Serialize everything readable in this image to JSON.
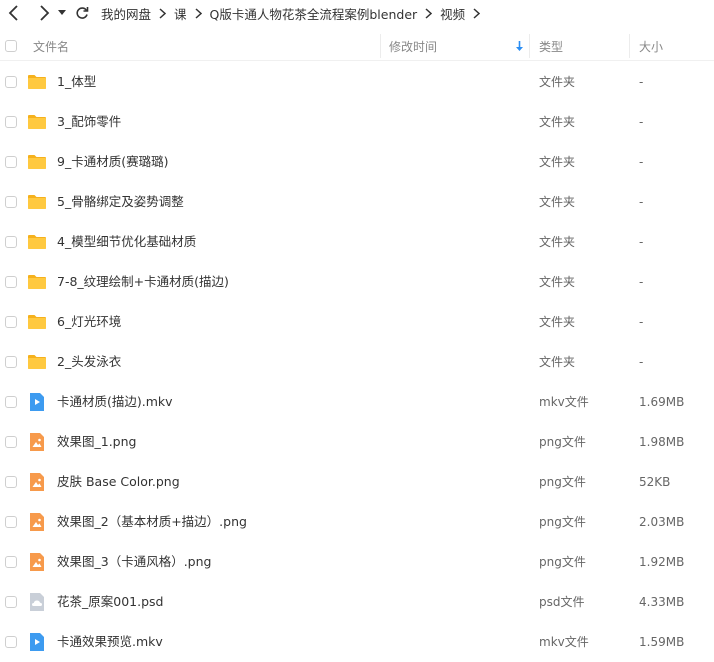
{
  "nav": {
    "back_icon": "chevron-left-icon",
    "forward_icon": "chevron-right-icon",
    "history_icon": "caret-down-icon",
    "refresh_icon": "refresh-icon"
  },
  "breadcrumb": [
    "我的网盘",
    "课",
    "Q版卡通人物花茶全流程案例blender",
    "视频"
  ],
  "columns": {
    "name": "文件名",
    "modified": "修改时间",
    "type": "类型",
    "size": "大小",
    "sort_icon": "sort-down-arrow-icon"
  },
  "colors": {
    "folder": "#ffc940",
    "folder_tab": "#f5b11d",
    "video": "#3d9bf0",
    "image": "#f79a4b",
    "psd": "#c9cfd8",
    "accent": "#2b8ef3"
  },
  "files": [
    {
      "name": "1_体型",
      "type": "文件夹",
      "size": "-",
      "icon": "folder-icon"
    },
    {
      "name": "3_配饰零件",
      "type": "文件夹",
      "size": "-",
      "icon": "folder-icon"
    },
    {
      "name": "9_卡通材质(赛璐璐)",
      "type": "文件夹",
      "size": "-",
      "icon": "folder-icon"
    },
    {
      "name": "5_骨骼绑定及姿势调整",
      "type": "文件夹",
      "size": "-",
      "icon": "folder-icon"
    },
    {
      "name": "4_模型细节优化基础材质",
      "type": "文件夹",
      "size": "-",
      "icon": "folder-icon"
    },
    {
      "name": "7-8_纹理绘制+卡通材质(描边)",
      "type": "文件夹",
      "size": "-",
      "icon": "folder-icon"
    },
    {
      "name": "6_灯光环境",
      "type": "文件夹",
      "size": "-",
      "icon": "folder-icon"
    },
    {
      "name": "2_头发泳衣",
      "type": "文件夹",
      "size": "-",
      "icon": "folder-icon"
    },
    {
      "name": "卡通材质(描边).mkv",
      "type": "mkv文件",
      "size": "1.69MB",
      "icon": "video-file-icon"
    },
    {
      "name": "效果图_1.png",
      "type": "png文件",
      "size": "1.98MB",
      "icon": "image-file-icon"
    },
    {
      "name": "皮肤 Base Color.png",
      "type": "png文件",
      "size": "52KB",
      "icon": "image-file-icon"
    },
    {
      "name": "效果图_2（基本材质+描边）.png",
      "type": "png文件",
      "size": "2.03MB",
      "icon": "image-file-icon"
    },
    {
      "name": "效果图_3（卡通风格）.png",
      "type": "png文件",
      "size": "1.92MB",
      "icon": "image-file-icon"
    },
    {
      "name": "花茶_原案001.psd",
      "type": "psd文件",
      "size": "4.33MB",
      "icon": "psd-file-icon"
    },
    {
      "name": "卡通效果预览.mkv",
      "type": "mkv文件",
      "size": "1.59MB",
      "icon": "video-file-icon"
    }
  ]
}
